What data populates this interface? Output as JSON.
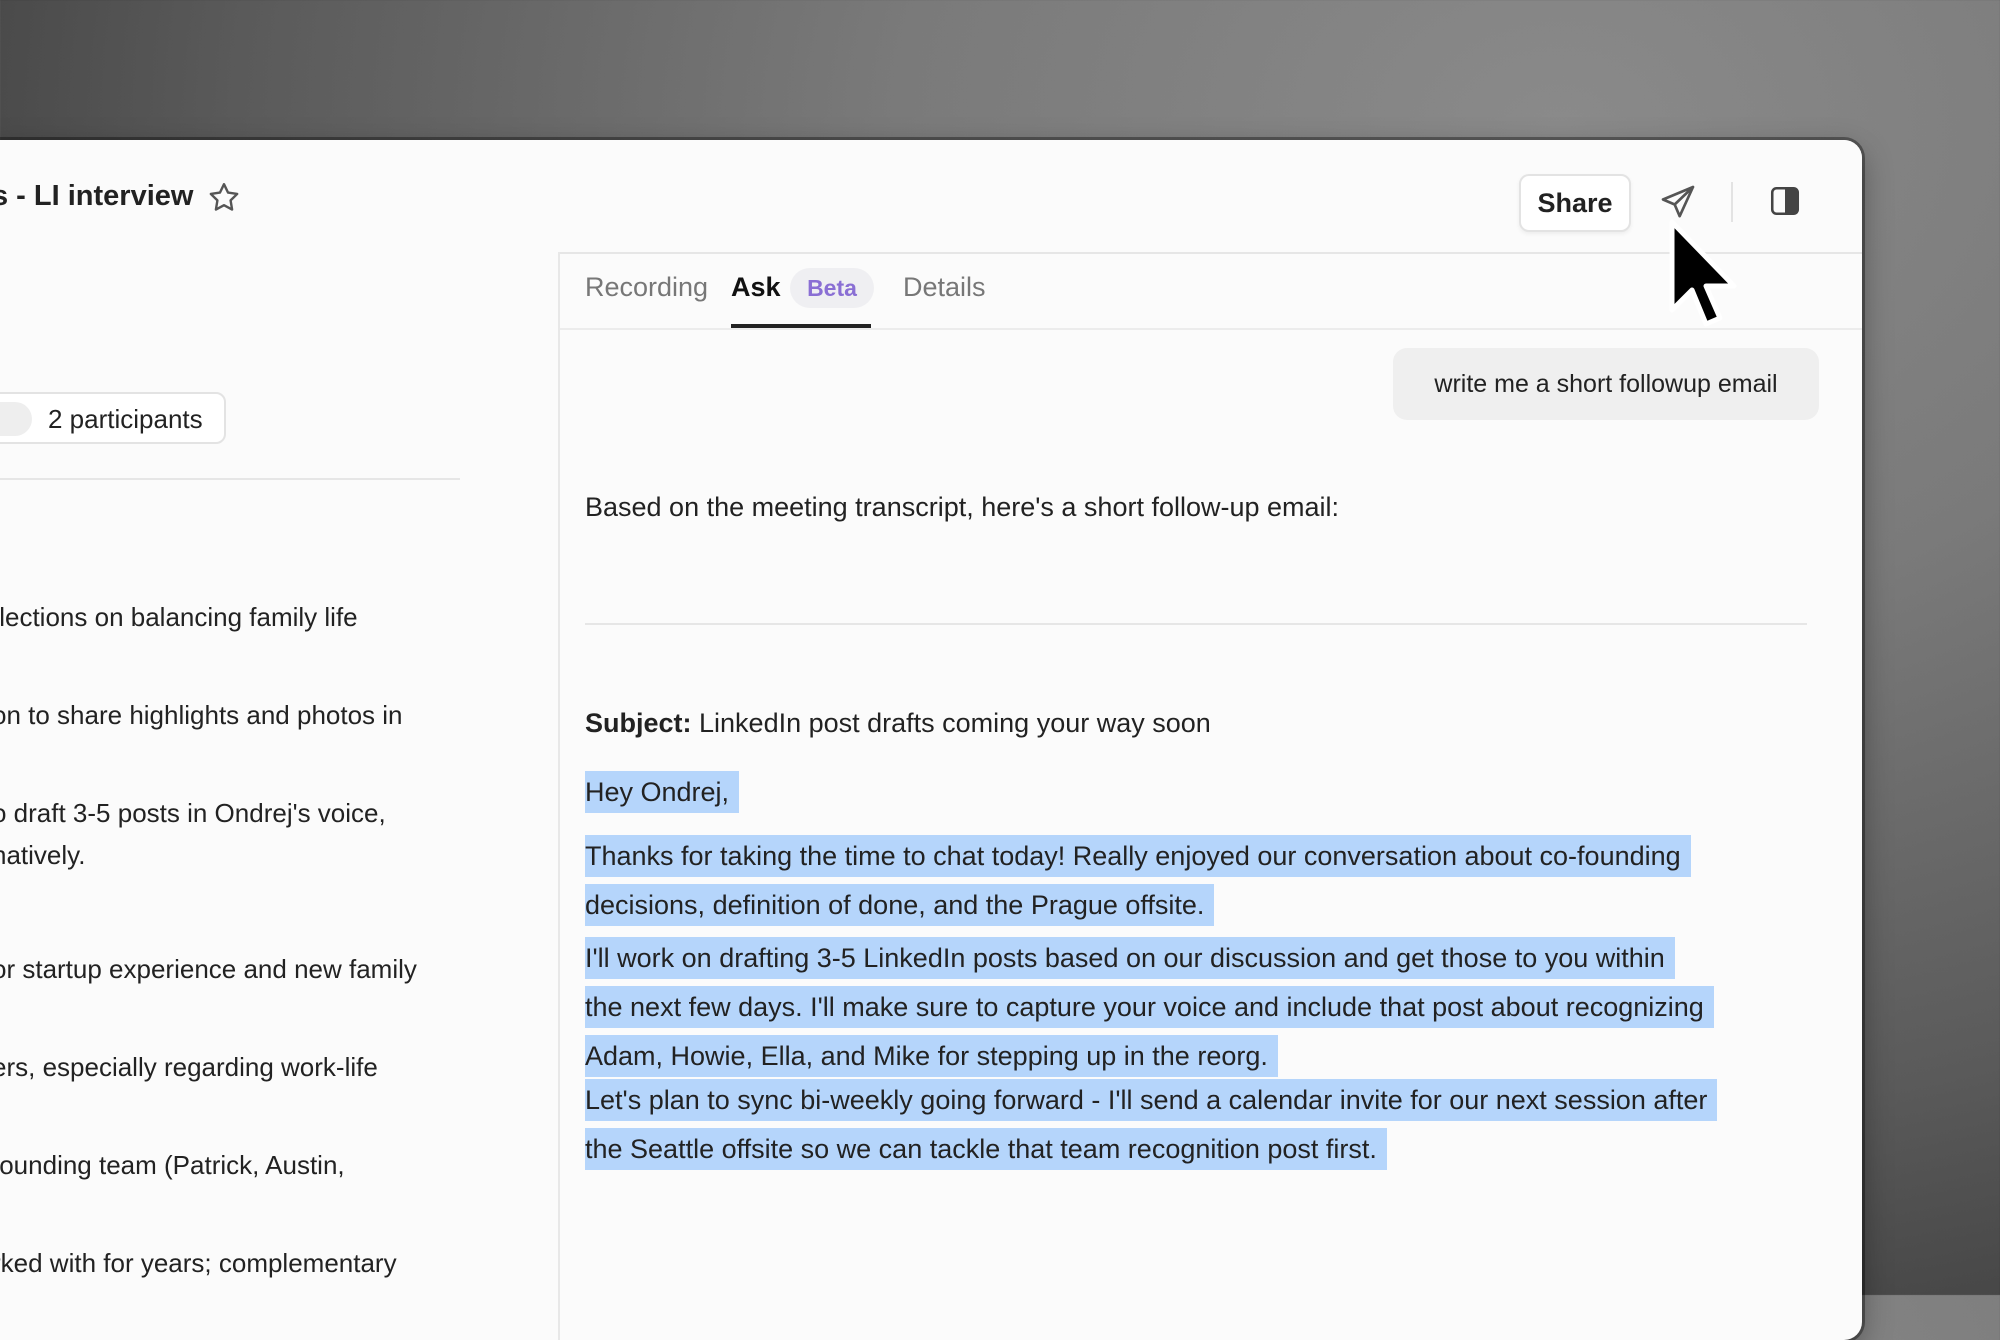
{
  "header": {
    "title": "s - LI interview",
    "share_label": "Share"
  },
  "left": {
    "participant_pill": "..",
    "participants_label": "2 participants",
    "lines": [
      "flections on balancing family life",
      "on to share highlights and photos in",
      "o draft 3-5 posts in Ondrej's voice,",
      "natively.",
      "or startup experience and new family",
      "ers, especially regarding work-life",
      "founding team (Patrick, Austin,",
      "rked with for years; complementary"
    ]
  },
  "tabs": {
    "recording": "Recording",
    "ask": "Ask",
    "beta": "Beta",
    "details": "Details"
  },
  "chat": {
    "user_message": "write me a short followup email",
    "intro": "Based on the meeting transcript, here's a short follow-up email:",
    "subject_label": "Subject:",
    "subject_text": " LinkedIn post drafts coming your way soon",
    "greeting": "Hey Ondrej,",
    "para1_line1": "Thanks for taking the time to chat today! Really enjoyed our conversation about co-founding",
    "para1_line2": "decisions, definition of done, and the Prague offsite.",
    "para2_line1": "I'll work on drafting 3-5 LinkedIn posts based on our discussion and get those to you within",
    "para2_line2": "the next few days. I'll make sure to capture your voice and include that post about recognizing",
    "para2_line3": "Adam, Howie, Ella, and Mike for stepping up in the reorg.",
    "para3_line1": "Let's plan to sync bi-weekly going forward - I'll send a calendar invite for our next session after",
    "para3_line2": "the Seattle offsite so we can tackle that team recognition post first."
  },
  "icons": {
    "star": "star-icon",
    "send": "send-icon",
    "panel": "sidebar-toggle-icon",
    "cursor": "cursor-icon"
  },
  "colors": {
    "highlight": "#b5d5fb",
    "beta_text": "#8a6fd4"
  }
}
